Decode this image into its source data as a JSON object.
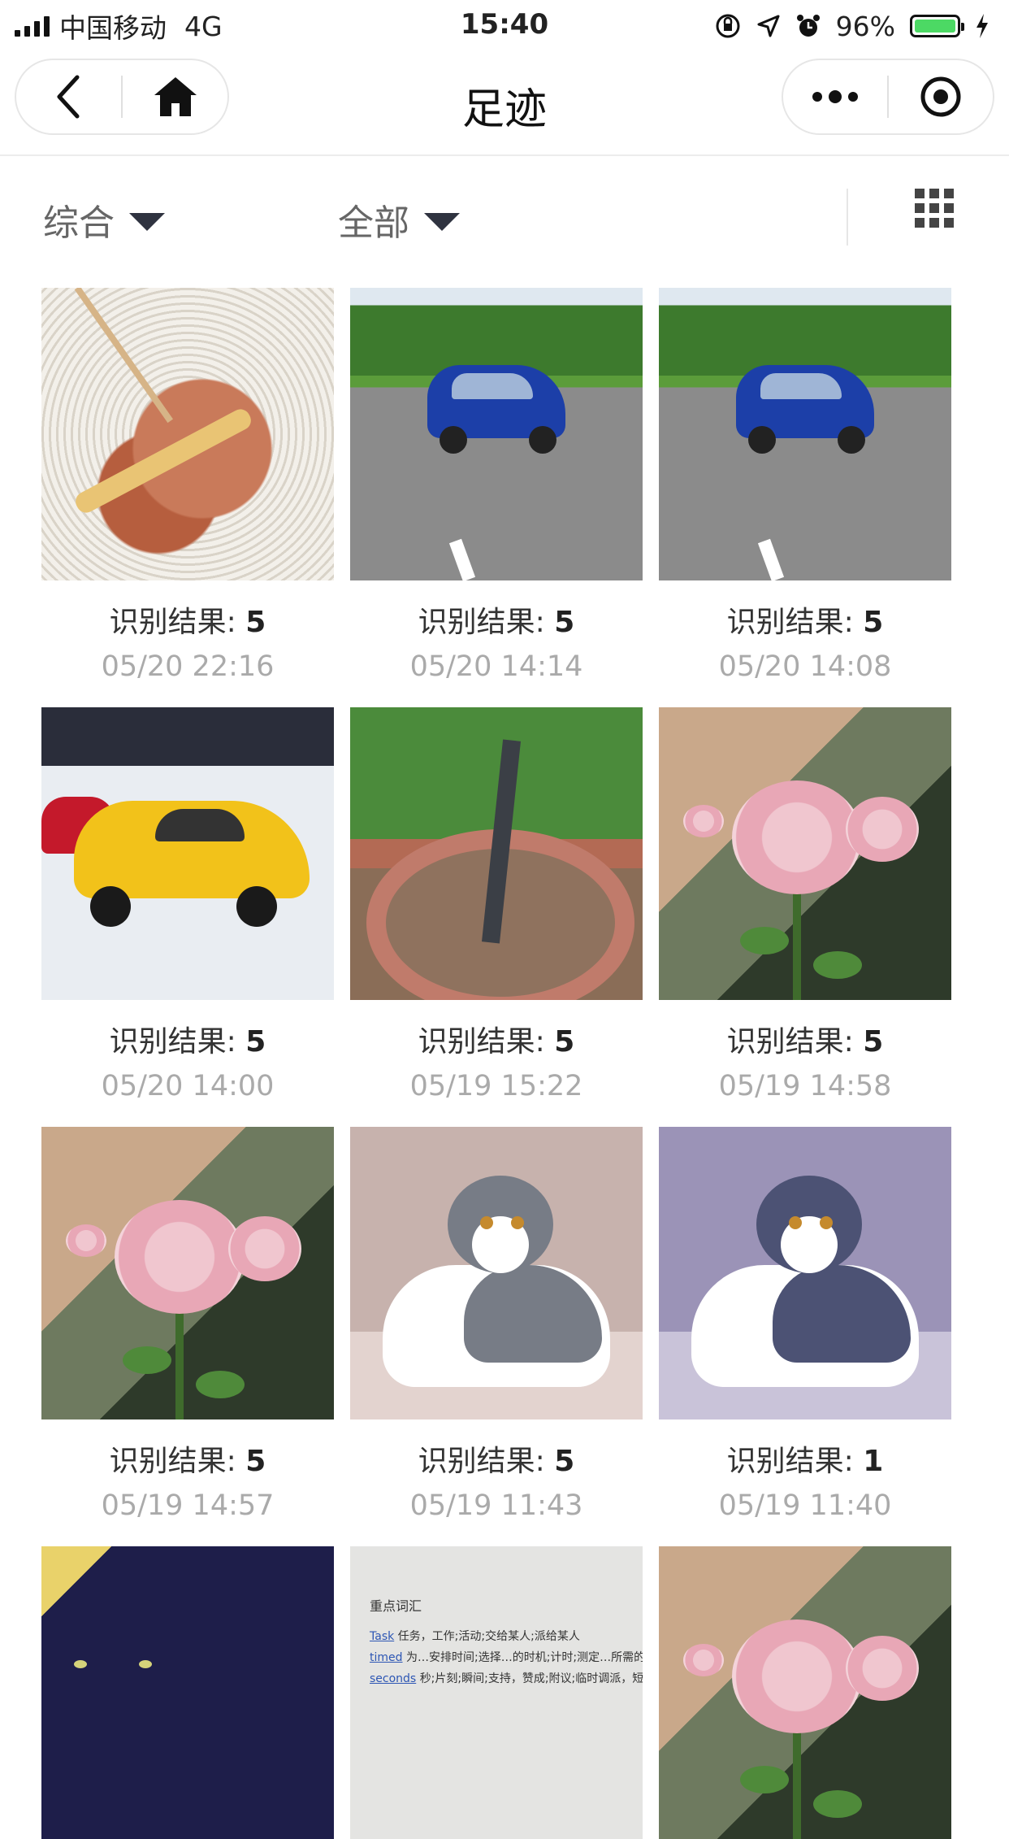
{
  "status_bar": {
    "carrier": "中国移动",
    "network": "4G",
    "time": "15:40",
    "battery": "96%",
    "battery_color": "#4cd964"
  },
  "nav": {
    "title": "足迹",
    "back_icon": "chevron-left-icon",
    "home_icon": "home-icon",
    "more_icon": "more-dots-icon",
    "close_icon": "target-icon"
  },
  "filters": {
    "sort": "综合",
    "category": "全部",
    "view_icon": "grid-icon"
  },
  "items": [
    {
      "thumb": "food",
      "label": "识别结果:",
      "value": "5",
      "date": "05/20 22:16"
    },
    {
      "thumb": "road-car",
      "label": "识别结果:",
      "value": "5",
      "date": "05/20 14:14"
    },
    {
      "thumb": "road-car",
      "label": "识别结果:",
      "value": "5",
      "date": "05/20 14:08"
    },
    {
      "thumb": "showroom-car",
      "label": "识别结果:",
      "value": "5",
      "date": "05/20 14:00"
    },
    {
      "thumb": "potted-plant",
      "label": "识别结果:",
      "value": "5",
      "date": "05/19 15:22"
    },
    {
      "thumb": "rose",
      "label": "识别结果:",
      "value": "5",
      "date": "05/19 14:58"
    },
    {
      "thumb": "rose",
      "label": "识别结果:",
      "value": "5",
      "date": "05/19 14:57"
    },
    {
      "thumb": "cat",
      "label": "识别结果:",
      "value": "5",
      "date": "05/19 11:43"
    },
    {
      "thumb": "cat-blue",
      "label": "识别结果:",
      "value": "1",
      "date": "05/19 11:40"
    },
    {
      "thumb": "panther"
    },
    {
      "thumb": "paper",
      "paper_lines": [
        {
          "heading": "重点词汇"
        },
        {
          "word": "Task",
          "meaning": "任务，工作;活动;交给某人;派给某人"
        },
        {
          "word": "timed",
          "meaning": "为…安排时间;选择…的时机;计时;测定…所需的时间"
        },
        {
          "word": "seconds",
          "meaning": "秒;片刻;瞬间;支持，赞成;附议;临时调派，短期借调"
        }
      ]
    },
    {
      "thumb": "rose"
    }
  ]
}
